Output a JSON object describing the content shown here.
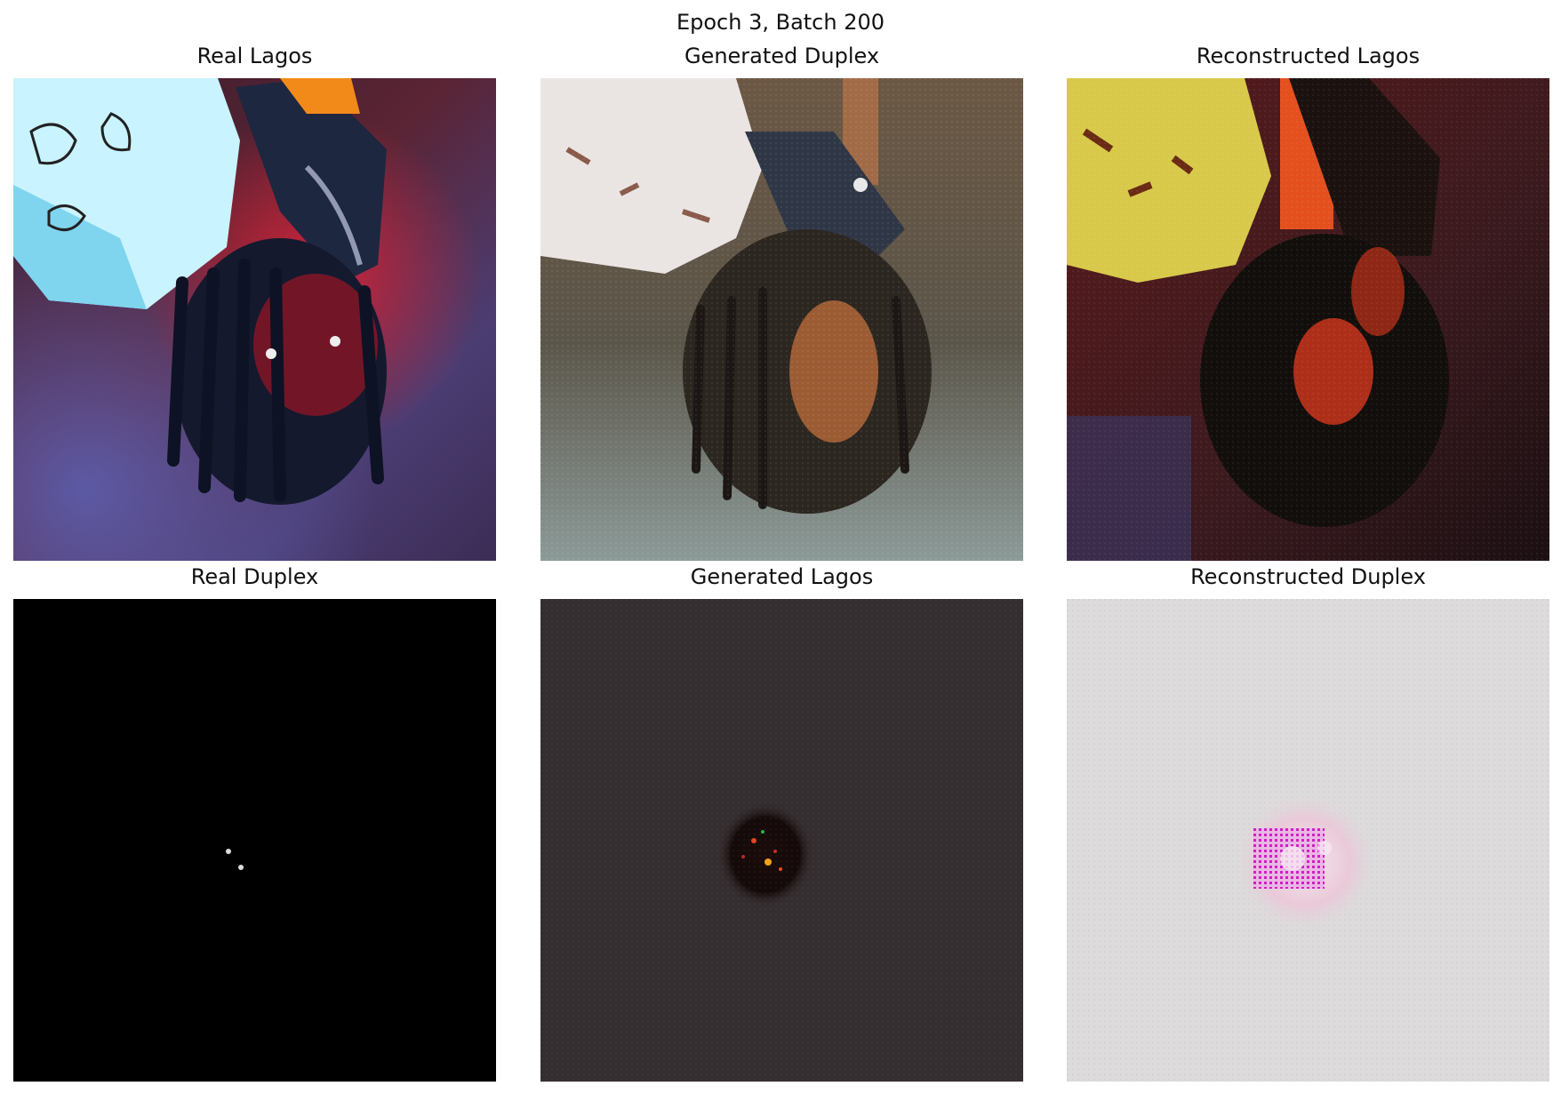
{
  "figure": {
    "title": "Epoch 3, Batch 200"
  },
  "panels": [
    {
      "title": "Real Lagos",
      "image": "real-lagos-photo"
    },
    {
      "title": "Generated Duplex",
      "image": "generated-duplex-image"
    },
    {
      "title": "Reconstructed Lagos",
      "image": "reconstructed-lagos-image"
    },
    {
      "title": "Real Duplex",
      "image": "real-duplex-image"
    },
    {
      "title": "Generated Lagos",
      "image": "generated-lagos-image"
    },
    {
      "title": "Reconstructed Duplex",
      "image": "reconstructed-duplex-image"
    }
  ]
}
